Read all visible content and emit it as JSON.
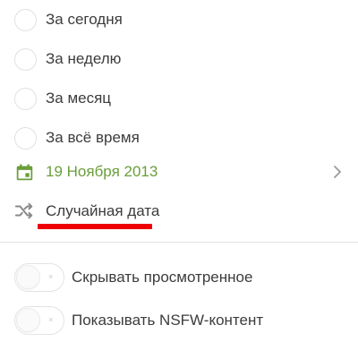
{
  "period_options": [
    {
      "label": "За сегодня",
      "selected": false
    },
    {
      "label": "За неделю",
      "selected": false
    },
    {
      "label": "За месяц",
      "selected": false
    },
    {
      "label": "За всё время",
      "selected": false
    }
  ],
  "date_picker": {
    "label": "19 Ноября 2013",
    "icon": "calendar-icon",
    "chevron": "chevron-right-icon",
    "color": "#6a9e3a"
  },
  "random_date": {
    "label": "Случайная дата",
    "icon": "shuffle-icon",
    "highlight_color": "#ee0000"
  },
  "toggles": [
    {
      "label": "Скрывать просмотренное",
      "enabled": false,
      "off_glyph": "×"
    },
    {
      "label": "Показывать NSFW-контент",
      "enabled": false,
      "off_glyph": "×"
    }
  ]
}
